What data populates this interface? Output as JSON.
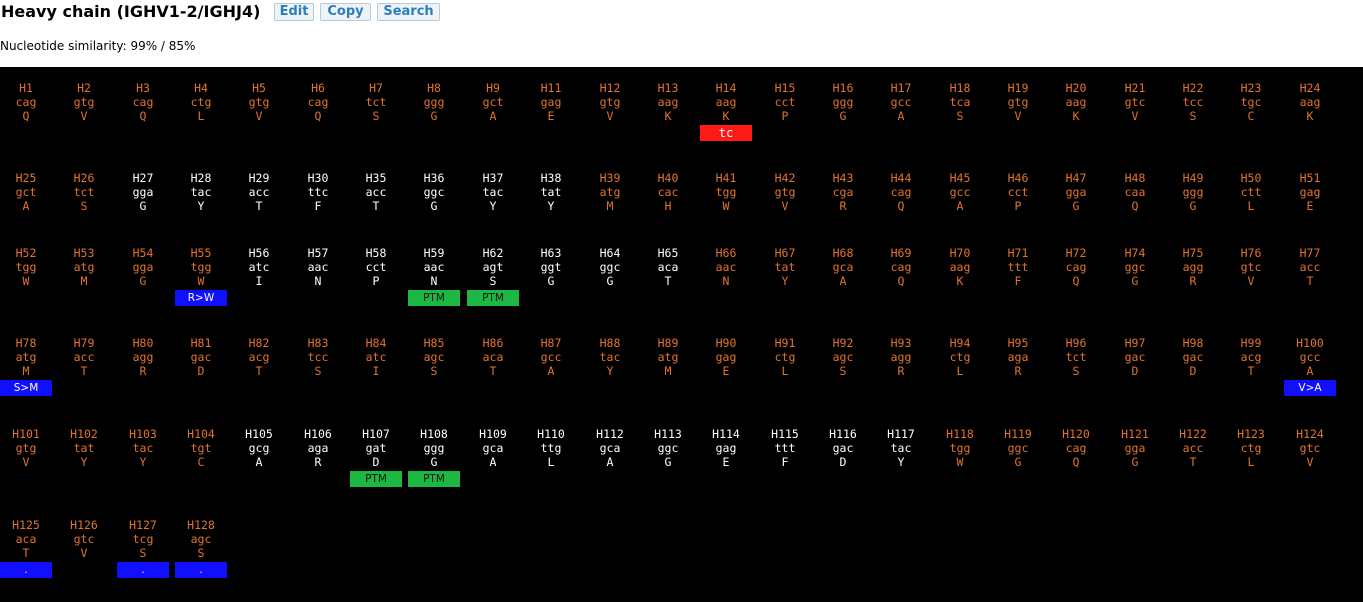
{
  "header": {
    "title": "Heavy chain (IGHV1-2/IGHJ4)",
    "buttons": [
      "Edit",
      "Copy",
      "Search"
    ],
    "similarity": "Nucleotide similarity: 99% / 85%"
  },
  "colors": {
    "germline": "#e2732e",
    "mutated": "#ffffff",
    "background": "#000000",
    "button_text": "#2b7fb8"
  },
  "rows": [
    [
      {
        "id": "H1",
        "codon": "cag",
        "aa": "Q",
        "c": "o"
      },
      {
        "id": "H2",
        "codon": "gtg",
        "aa": "V",
        "c": "o"
      },
      {
        "id": "H3",
        "codon": "cag",
        "aa": "Q",
        "c": "o"
      },
      {
        "id": "H4",
        "codon": "ctg",
        "aa": "L",
        "c": "o"
      },
      {
        "id": "H5",
        "codon": "gtg",
        "aa": "V",
        "c": "o"
      },
      {
        "id": "H6",
        "codon": "cag",
        "aa": "Q",
        "c": "o"
      },
      {
        "id": "H7",
        "codon": "tct",
        "aa": "S",
        "c": "o"
      },
      {
        "id": "H8",
        "codon": "ggg",
        "aa": "G",
        "c": "o"
      },
      {
        "id": "H9",
        "codon": "gct",
        "aa": "A",
        "c": "o"
      },
      {
        "id": "H11",
        "codon": "gag",
        "aa": "E",
        "c": "o"
      },
      {
        "id": "H12",
        "codon": "gtg",
        "aa": "V",
        "c": "o"
      },
      {
        "id": "H13",
        "codon": "aag",
        "aa": "K",
        "c": "o"
      },
      {
        "id": "H14",
        "codon": "aag",
        "aa": "K",
        "c": "o",
        "tag": "tc",
        "tagColor": "red"
      },
      {
        "id": "H15",
        "codon": "cct",
        "aa": "P",
        "c": "o"
      },
      {
        "id": "H16",
        "codon": "ggg",
        "aa": "G",
        "c": "o"
      },
      {
        "id": "H17",
        "codon": "gcc",
        "aa": "A",
        "c": "o"
      },
      {
        "id": "H18",
        "codon": "tca",
        "aa": "S",
        "c": "o"
      },
      {
        "id": "H19",
        "codon": "gtg",
        "aa": "V",
        "c": "o"
      },
      {
        "id": "H20",
        "codon": "aag",
        "aa": "K",
        "c": "o"
      },
      {
        "id": "H21",
        "codon": "gtc",
        "aa": "V",
        "c": "o"
      },
      {
        "id": "H22",
        "codon": "tcc",
        "aa": "S",
        "c": "o"
      },
      {
        "id": "H23",
        "codon": "tgc",
        "aa": "C",
        "c": "o"
      },
      {
        "id": "H24",
        "codon": "aag",
        "aa": "K",
        "c": "o"
      }
    ],
    [
      {
        "id": "H25",
        "codon": "gct",
        "aa": "A",
        "c": "o"
      },
      {
        "id": "H26",
        "codon": "tct",
        "aa": "S",
        "c": "o"
      },
      {
        "id": "H27",
        "codon": "gga",
        "aa": "G",
        "c": "w"
      },
      {
        "id": "H28",
        "codon": "tac",
        "aa": "Y",
        "c": "w"
      },
      {
        "id": "H29",
        "codon": "acc",
        "aa": "T",
        "c": "w"
      },
      {
        "id": "H30",
        "codon": "ttc",
        "aa": "F",
        "c": "w"
      },
      {
        "id": "H35",
        "codon": "acc",
        "aa": "T",
        "c": "w"
      },
      {
        "id": "H36",
        "codon": "ggc",
        "aa": "G",
        "c": "w"
      },
      {
        "id": "H37",
        "codon": "tac",
        "aa": "Y",
        "c": "w"
      },
      {
        "id": "H38",
        "codon": "tat",
        "aa": "Y",
        "c": "w"
      },
      {
        "id": "H39",
        "codon": "atg",
        "aa": "M",
        "c": "o"
      },
      {
        "id": "H40",
        "codon": "cac",
        "aa": "H",
        "c": "o"
      },
      {
        "id": "H41",
        "codon": "tgg",
        "aa": "W",
        "c": "o"
      },
      {
        "id": "H42",
        "codon": "gtg",
        "aa": "V",
        "c": "o"
      },
      {
        "id": "H43",
        "codon": "cga",
        "aa": "R",
        "c": "o"
      },
      {
        "id": "H44",
        "codon": "cag",
        "aa": "Q",
        "c": "o"
      },
      {
        "id": "H45",
        "codon": "gcc",
        "aa": "A",
        "c": "o"
      },
      {
        "id": "H46",
        "codon": "cct",
        "aa": "P",
        "c": "o"
      },
      {
        "id": "H47",
        "codon": "gga",
        "aa": "G",
        "c": "o"
      },
      {
        "id": "H48",
        "codon": "caa",
        "aa": "Q",
        "c": "o"
      },
      {
        "id": "H49",
        "codon": "ggg",
        "aa": "G",
        "c": "o"
      },
      {
        "id": "H50",
        "codon": "ctt",
        "aa": "L",
        "c": "o"
      },
      {
        "id": "H51",
        "codon": "gag",
        "aa": "E",
        "c": "o"
      }
    ],
    [
      {
        "id": "H52",
        "codon": "tgg",
        "aa": "W",
        "c": "o"
      },
      {
        "id": "H53",
        "codon": "atg",
        "aa": "M",
        "c": "o"
      },
      {
        "id": "H54",
        "codon": "gga",
        "aa": "G",
        "c": "o"
      },
      {
        "id": "H55",
        "codon": "tgg",
        "aa": "W",
        "c": "o",
        "tag": "R>W",
        "tagColor": "blue"
      },
      {
        "id": "H56",
        "codon": "atc",
        "aa": "I",
        "c": "w"
      },
      {
        "id": "H57",
        "codon": "aac",
        "aa": "N",
        "c": "w"
      },
      {
        "id": "H58",
        "codon": "cct",
        "aa": "P",
        "c": "w"
      },
      {
        "id": "H59",
        "codon": "aac",
        "aa": "N",
        "c": "w",
        "tag": "PTM",
        "tagColor": "green"
      },
      {
        "id": "H62",
        "codon": "agt",
        "aa": "S",
        "c": "w",
        "tag": "PTM",
        "tagColor": "green"
      },
      {
        "id": "H63",
        "codon": "ggt",
        "aa": "G",
        "c": "w"
      },
      {
        "id": "H64",
        "codon": "ggc",
        "aa": "G",
        "c": "w"
      },
      {
        "id": "H65",
        "codon": "aca",
        "aa": "T",
        "c": "w"
      },
      {
        "id": "H66",
        "codon": "aac",
        "aa": "N",
        "c": "o"
      },
      {
        "id": "H67",
        "codon": "tat",
        "aa": "Y",
        "c": "o"
      },
      {
        "id": "H68",
        "codon": "gca",
        "aa": "A",
        "c": "o"
      },
      {
        "id": "H69",
        "codon": "cag",
        "aa": "Q",
        "c": "o"
      },
      {
        "id": "H70",
        "codon": "aag",
        "aa": "K",
        "c": "o"
      },
      {
        "id": "H71",
        "codon": "ttt",
        "aa": "F",
        "c": "o"
      },
      {
        "id": "H72",
        "codon": "cag",
        "aa": "Q",
        "c": "o"
      },
      {
        "id": "H74",
        "codon": "ggc",
        "aa": "G",
        "c": "o"
      },
      {
        "id": "H75",
        "codon": "agg",
        "aa": "R",
        "c": "o"
      },
      {
        "id": "H76",
        "codon": "gtc",
        "aa": "V",
        "c": "o"
      },
      {
        "id": "H77",
        "codon": "acc",
        "aa": "T",
        "c": "o"
      }
    ],
    [
      {
        "id": "H78",
        "codon": "atg",
        "aa": "M",
        "c": "o",
        "tag": "S>M",
        "tagColor": "blue"
      },
      {
        "id": "H79",
        "codon": "acc",
        "aa": "T",
        "c": "o"
      },
      {
        "id": "H80",
        "codon": "agg",
        "aa": "R",
        "c": "o"
      },
      {
        "id": "H81",
        "codon": "gac",
        "aa": "D",
        "c": "o"
      },
      {
        "id": "H82",
        "codon": "acg",
        "aa": "T",
        "c": "o"
      },
      {
        "id": "H83",
        "codon": "tcc",
        "aa": "S",
        "c": "o"
      },
      {
        "id": "H84",
        "codon": "atc",
        "aa": "I",
        "c": "o"
      },
      {
        "id": "H85",
        "codon": "agc",
        "aa": "S",
        "c": "o"
      },
      {
        "id": "H86",
        "codon": "aca",
        "aa": "T",
        "c": "o"
      },
      {
        "id": "H87",
        "codon": "gcc",
        "aa": "A",
        "c": "o"
      },
      {
        "id": "H88",
        "codon": "tac",
        "aa": "Y",
        "c": "o"
      },
      {
        "id": "H89",
        "codon": "atg",
        "aa": "M",
        "c": "o"
      },
      {
        "id": "H90",
        "codon": "gag",
        "aa": "E",
        "c": "o"
      },
      {
        "id": "H91",
        "codon": "ctg",
        "aa": "L",
        "c": "o"
      },
      {
        "id": "H92",
        "codon": "agc",
        "aa": "S",
        "c": "o"
      },
      {
        "id": "H93",
        "codon": "agg",
        "aa": "R",
        "c": "o"
      },
      {
        "id": "H94",
        "codon": "ctg",
        "aa": "L",
        "c": "o"
      },
      {
        "id": "H95",
        "codon": "aga",
        "aa": "R",
        "c": "o"
      },
      {
        "id": "H96",
        "codon": "tct",
        "aa": "S",
        "c": "o"
      },
      {
        "id": "H97",
        "codon": "gac",
        "aa": "D",
        "c": "o"
      },
      {
        "id": "H98",
        "codon": "gac",
        "aa": "D",
        "c": "o"
      },
      {
        "id": "H99",
        "codon": "acg",
        "aa": "T",
        "c": "o"
      },
      {
        "id": "H100",
        "codon": "gcc",
        "aa": "A",
        "c": "o",
        "tag": "V>A",
        "tagColor": "blue"
      }
    ],
    [
      {
        "id": "H101",
        "codon": "gtg",
        "aa": "V",
        "c": "o"
      },
      {
        "id": "H102",
        "codon": "tat",
        "aa": "Y",
        "c": "o"
      },
      {
        "id": "H103",
        "codon": "tac",
        "aa": "Y",
        "c": "o"
      },
      {
        "id": "H104",
        "codon": "tgt",
        "aa": "C",
        "c": "o"
      },
      {
        "id": "H105",
        "codon": "gcg",
        "aa": "A",
        "c": "w"
      },
      {
        "id": "H106",
        "codon": "aga",
        "aa": "R",
        "c": "w"
      },
      {
        "id": "H107",
        "codon": "gat",
        "aa": "D",
        "c": "w",
        "tag": "PTM",
        "tagColor": "green"
      },
      {
        "id": "H108",
        "codon": "ggg",
        "aa": "G",
        "c": "w",
        "tag": "PTM",
        "tagColor": "green"
      },
      {
        "id": "H109",
        "codon": "gca",
        "aa": "A",
        "c": "w"
      },
      {
        "id": "H110",
        "codon": "ttg",
        "aa": "L",
        "c": "w"
      },
      {
        "id": "H112",
        "codon": "gca",
        "aa": "A",
        "c": "w"
      },
      {
        "id": "H113",
        "codon": "ggc",
        "aa": "G",
        "c": "w"
      },
      {
        "id": "H114",
        "codon": "gag",
        "aa": "E",
        "c": "w"
      },
      {
        "id": "H115",
        "codon": "ttt",
        "aa": "F",
        "c": "w"
      },
      {
        "id": "H116",
        "codon": "gac",
        "aa": "D",
        "c": "w"
      },
      {
        "id": "H117",
        "codon": "tac",
        "aa": "Y",
        "c": "w"
      },
      {
        "id": "H118",
        "codon": "tgg",
        "aa": "W",
        "c": "o"
      },
      {
        "id": "H119",
        "codon": "ggc",
        "aa": "G",
        "c": "o"
      },
      {
        "id": "H120",
        "codon": "cag",
        "aa": "Q",
        "c": "o"
      },
      {
        "id": "H121",
        "codon": "gga",
        "aa": "G",
        "c": "o"
      },
      {
        "id": "H122",
        "codon": "acc",
        "aa": "T",
        "c": "o"
      },
      {
        "id": "H123",
        "codon": "ctg",
        "aa": "L",
        "c": "o"
      },
      {
        "id": "H124",
        "codon": "gtc",
        "aa": "V",
        "c": "o"
      }
    ],
    [
      {
        "id": "H125",
        "codon": "aca",
        "aa": "T",
        "c": "o",
        "tag": ".",
        "tagColor": "blue"
      },
      {
        "id": "H126",
        "codon": "gtc",
        "aa": "V",
        "c": "o"
      },
      {
        "id": "H127",
        "codon": "tcg",
        "aa": "S",
        "c": "o",
        "tag": ".",
        "tagColor": "blue"
      },
      {
        "id": "H128",
        "codon": "agc",
        "aa": "S",
        "c": "o",
        "tag": ".",
        "tagColor": "blue"
      }
    ]
  ]
}
